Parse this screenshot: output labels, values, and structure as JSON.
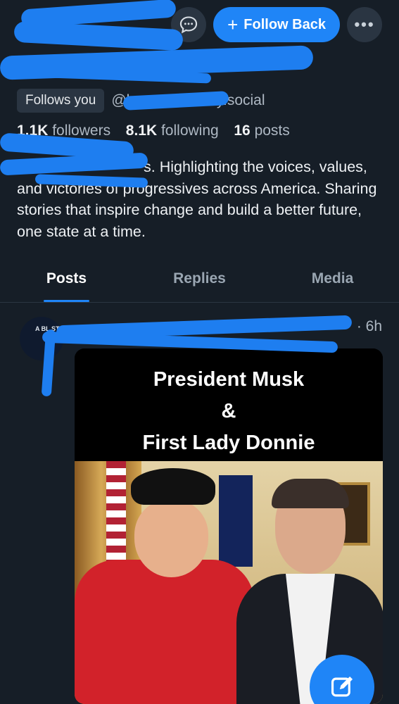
{
  "header": {
    "follow_back_label": "Follow Back",
    "plus_glyph": "+",
    "more_glyph": "•••",
    "message_icon": "chat-bubble-icon"
  },
  "profile": {
    "follows_you_badge": "Follows you",
    "handle_visible": "@l                 evens13.bsky.social",
    "followers_count": "1.1K",
    "followers_label": "followers",
    "following_count": "8.1K",
    "following_label": "following",
    "posts_count": "16",
    "posts_label": "posts",
    "bio": "s. Highlighting the voices, values, and victories of progressives across America. Sharing stories that inspire change and build a better future, one state at a time."
  },
  "tabs": [
    {
      "label": "Posts",
      "active": true
    },
    {
      "label": "Replies",
      "active": false
    },
    {
      "label": "Media",
      "active": false
    }
  ],
  "post": {
    "avatar_text": "A BL ST",
    "time": "· 6h",
    "image_caption": {
      "line1": "President Musk",
      "line2": "&",
      "line3": "First Lady Donnie"
    }
  },
  "colors": {
    "background": "#161e27",
    "accent": "#1f85f7",
    "redaction": "#1e7ef0"
  }
}
